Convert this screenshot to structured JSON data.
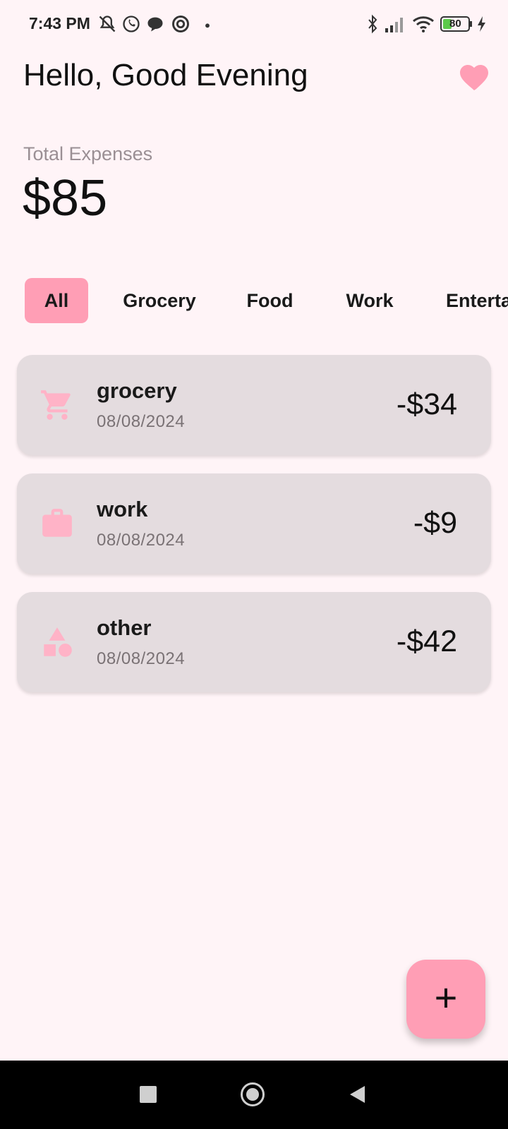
{
  "status_bar": {
    "time": "7:43 PM",
    "battery": "80",
    "icons_left": [
      "mute-icon",
      "whatsapp-icon",
      "chat-icon",
      "sync-icon",
      "dot-icon"
    ],
    "icons_right": [
      "bluetooth-icon",
      "signal-icon",
      "wifi-icon",
      "battery-icon",
      "charging-icon"
    ]
  },
  "header": {
    "greeting": "Hello, Good Evening",
    "action_icon": "heart-icon"
  },
  "summary": {
    "label": "Total Expenses",
    "value": "$85"
  },
  "filters": {
    "selected": "All",
    "items": [
      "All",
      "Grocery",
      "Food",
      "Work",
      "Entertainment"
    ]
  },
  "transactions": [
    {
      "title": "grocery",
      "date": "08/08/2024",
      "amount": "-$34",
      "icon": "cart-icon"
    },
    {
      "title": "work",
      "date": "08/08/2024",
      "amount": "-$9",
      "icon": "briefcase-icon"
    },
    {
      "title": "other",
      "date": "08/08/2024",
      "amount": "-$42",
      "icon": "shapes-icon"
    }
  ],
  "fab": {
    "label": "+"
  },
  "colors": {
    "background": "#fff4f7",
    "accent": "#ff9eb5",
    "card": "#e4dcdf",
    "icon_pink": "#ffb3c7"
  }
}
